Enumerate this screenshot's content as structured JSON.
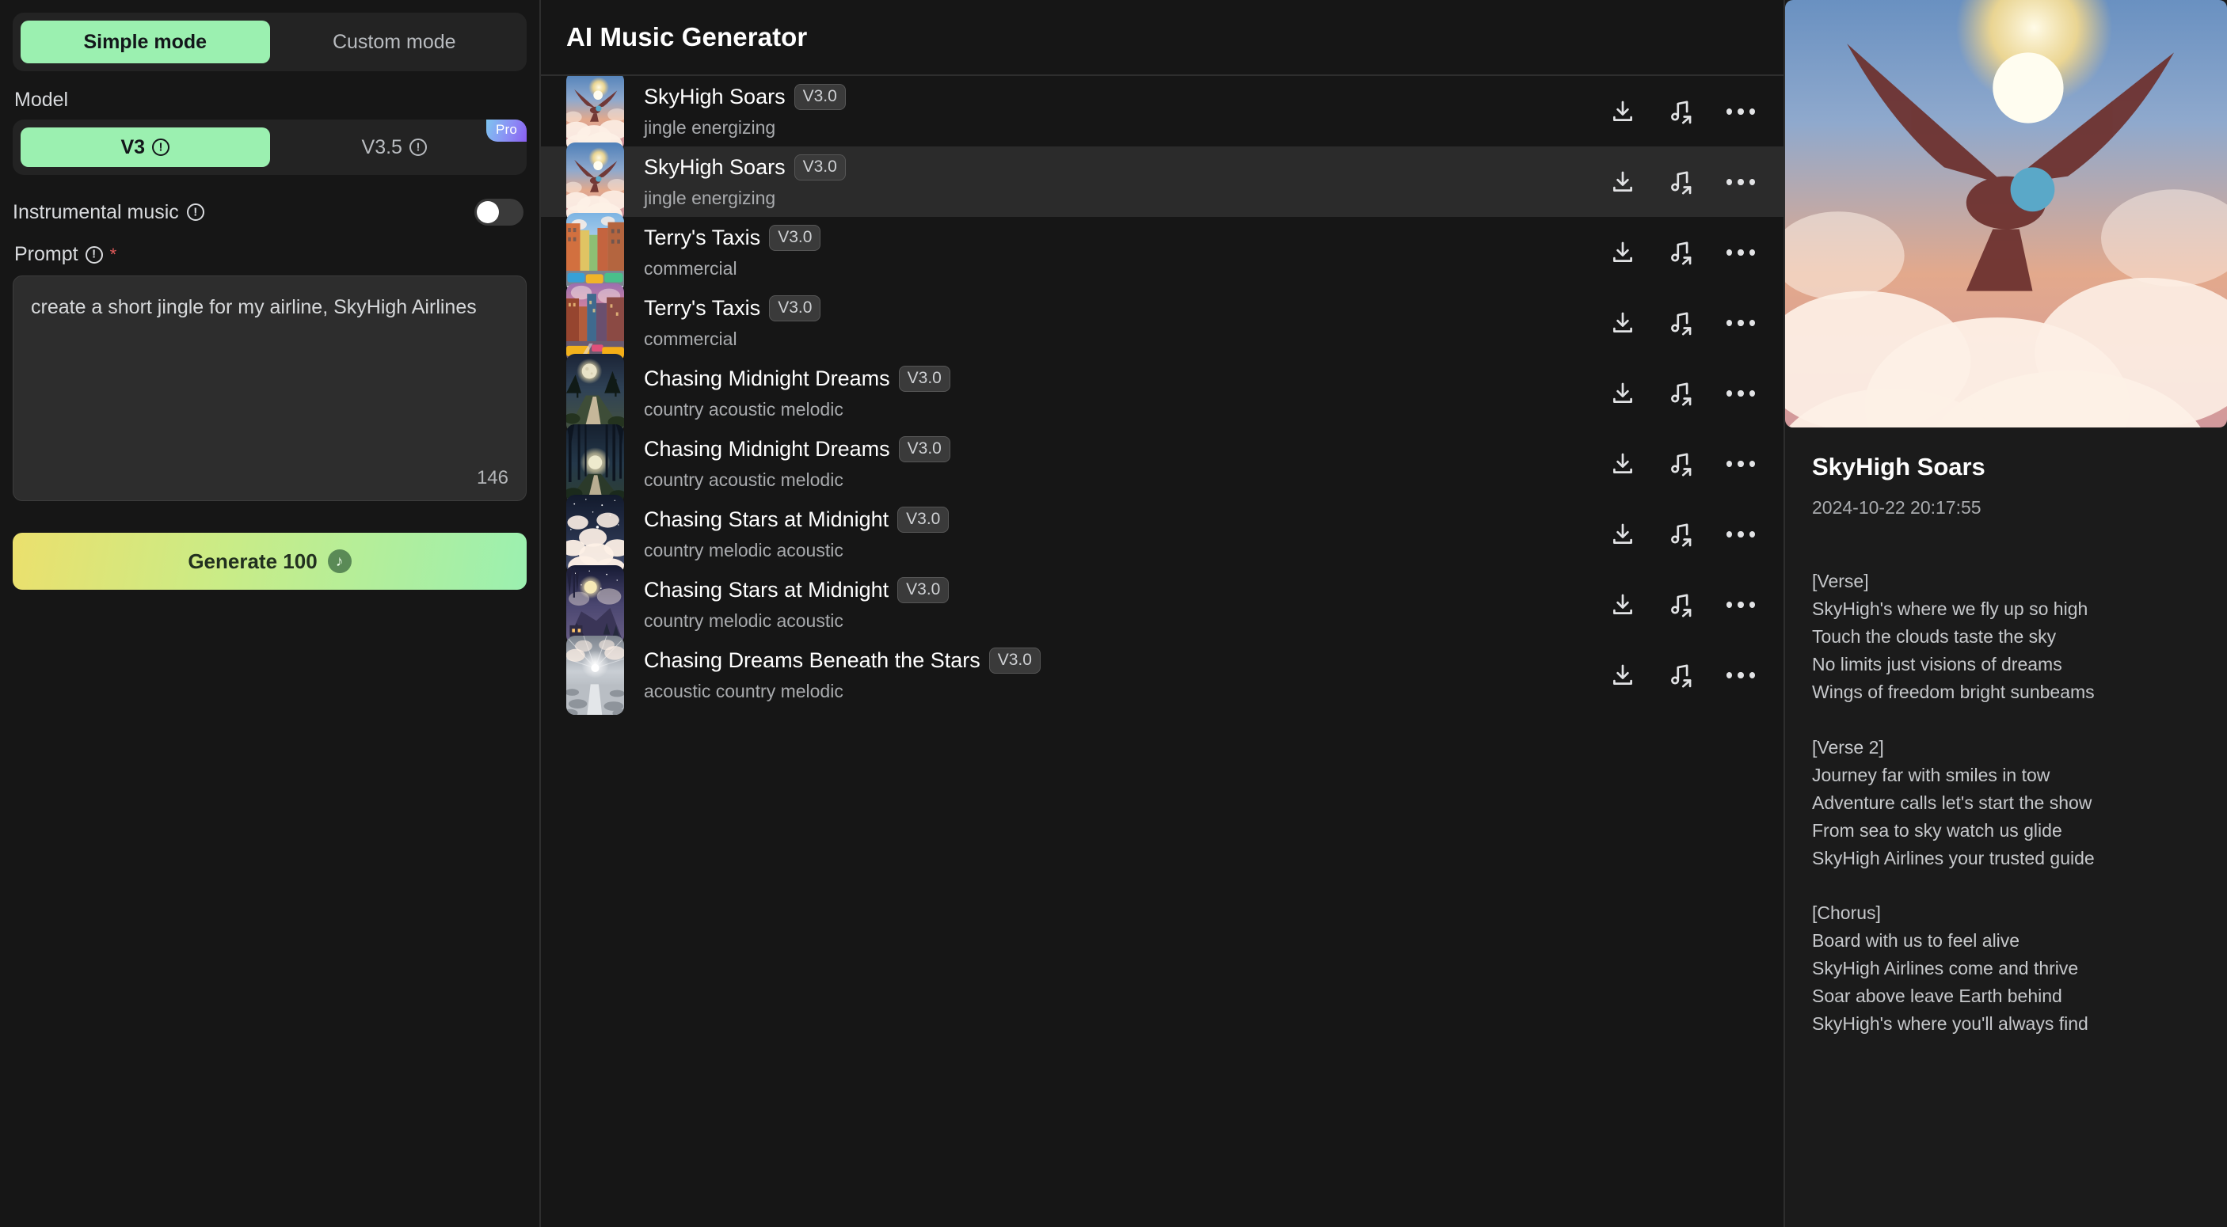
{
  "sidebar": {
    "mode_tabs": [
      {
        "label": "Simple mode",
        "active": true
      },
      {
        "label": "Custom mode",
        "active": false
      }
    ],
    "model_label": "Model",
    "model_options": [
      {
        "label": "V3",
        "active": true,
        "badge": ""
      },
      {
        "label": "V3.5",
        "active": false,
        "badge": "Pro"
      }
    ],
    "instrumental_label": "Instrumental music",
    "instrumental_on": false,
    "prompt_label": "Prompt",
    "prompt_required_mark": "*",
    "prompt_value": "create a short jingle for my airline, SkyHigh Airlines",
    "prompt_char_count": "146",
    "generate_label": "Generate 100",
    "generate_coin_icon": "music-note-coin-icon"
  },
  "main": {
    "title": "AI Music Generator",
    "tracks": [
      {
        "title": "SkyHigh Soars",
        "version": "V3.0",
        "tags": "jingle energizing",
        "selected": false,
        "art": "eagle-sunset"
      },
      {
        "title": "SkyHigh Soars",
        "version": "V3.0",
        "tags": "jingle energizing",
        "selected": true,
        "art": "eagle-sunset"
      },
      {
        "title": "Terry's Taxis",
        "version": "V3.0",
        "tags": "commercial",
        "selected": false,
        "art": "city-day"
      },
      {
        "title": "Terry's Taxis",
        "version": "V3.0",
        "tags": "commercial",
        "selected": false,
        "art": "city-dusk"
      },
      {
        "title": "Chasing Midnight Dreams",
        "version": "V3.0",
        "tags": "country acoustic melodic",
        "selected": false,
        "art": "moon-path"
      },
      {
        "title": "Chasing Midnight Dreams",
        "version": "V3.0",
        "tags": "country acoustic melodic",
        "selected": false,
        "art": "forest-moon"
      },
      {
        "title": "Chasing Stars at Midnight",
        "version": "V3.0",
        "tags": "country melodic acoustic",
        "selected": false,
        "art": "starry-clouds"
      },
      {
        "title": "Chasing Stars at Midnight",
        "version": "V3.0",
        "tags": "country melodic acoustic",
        "selected": false,
        "art": "moon-valley"
      },
      {
        "title": "Chasing Dreams Beneath the Stars",
        "version": "V3.0",
        "tags": "acoustic country melodic",
        "selected": false,
        "art": "sunburst-field"
      }
    ],
    "row_actions": [
      {
        "name": "download-icon",
        "label": "Download"
      },
      {
        "name": "extend-music-icon",
        "label": "Extend"
      },
      {
        "name": "more-options-icon",
        "label": "More"
      }
    ]
  },
  "detail": {
    "cover_art": "eagle-sunset",
    "title": "SkyHigh Soars",
    "timestamp": "2024-10-22 20:17:55",
    "lyrics": "[Verse]\nSkyHigh's where we fly up so high\nTouch the clouds taste the sky\nNo limits just visions of dreams\nWings of freedom bright sunbeams\n\n[Verse 2]\nJourney far with smiles in tow\nAdventure calls let's start the show\nFrom sea to sky watch us glide\nSkyHigh Airlines your trusted guide\n\n[Chorus]\nBoard with us to feel alive\nSkyHigh Airlines come and thrive\nSoar above leave Earth behind\nSkyHigh's where you'll always find"
  },
  "colors": {
    "accent_green": "#9bf0b0",
    "pro_badge_gradient_start": "#7ec5ef",
    "pro_badge_gradient_end": "#8a5ef0",
    "generate_gradient_start": "#ebe06d",
    "generate_gradient_end": "#9bf0b0",
    "background": "#161616",
    "panel_background": "#1b1b1b",
    "selected_row": "#2b2b2b",
    "required_star": "#e35b5b"
  }
}
